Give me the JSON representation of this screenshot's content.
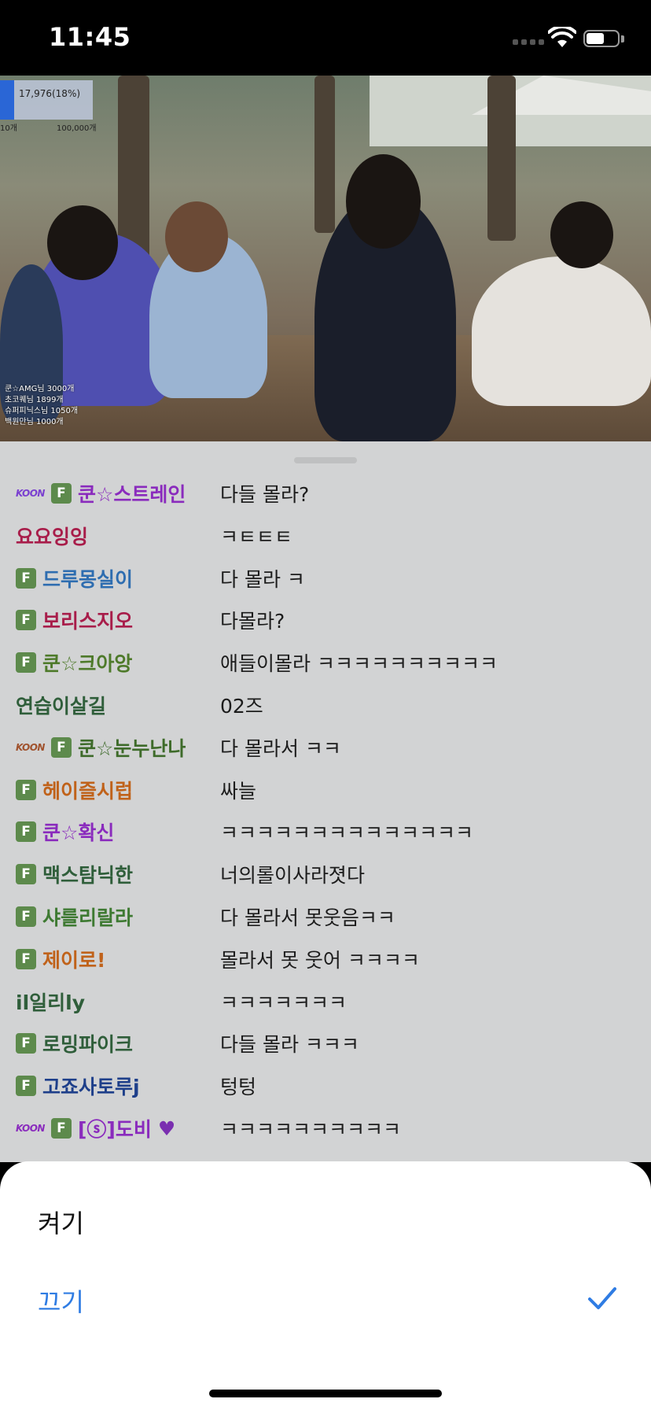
{
  "status_bar": {
    "time": "11:45"
  },
  "video": {
    "stat_main": "17,976(18%)",
    "stat_left": "10개",
    "stat_right": "100,000개",
    "donors": [
      "쿤☆AMG님 3000개",
      "초코퀘님 1899개",
      "슈퍼피닉스님 1050개",
      "백원만님 1000개"
    ]
  },
  "chat": {
    "messages": [
      {
        "user": "쿤☆스트레인",
        "color": "#8a2bbd",
        "koon": "KOON",
        "koon_color": "#7a3fd0",
        "fan": "F",
        "text": "다들 몰라?"
      },
      {
        "user": "요요잉잉",
        "color": "#a81d4a",
        "koon": "",
        "fan": "",
        "text": "ㅋㅌㅌㅌ"
      },
      {
        "user": "드루몽실이",
        "color": "#2e6db0",
        "koon": "",
        "fan": "F",
        "text": "다 몰라 ㅋ"
      },
      {
        "user": "보리스지오",
        "color": "#a81d4a",
        "koon": "",
        "fan": "F",
        "text": "다몰라?"
      },
      {
        "user": "쿤☆크아앙",
        "color": "#4e7a2a",
        "koon": "",
        "fan": "F",
        "text": "애들이몰라 ㅋㅋㅋㅋㅋㅋㅋㅋㅋㅋ"
      },
      {
        "user": "연습이살길",
        "color": "#2f5e3a",
        "koon": "",
        "fan": "",
        "text": "02즈"
      },
      {
        "user": "쿤☆눈누난나",
        "color": "#3e6b2a",
        "koon": "KOON",
        "koon_color": "#a0522d",
        "fan": "F",
        "text": "다 몰라서 ㅋㅋ"
      },
      {
        "user": "헤이즐시럽",
        "color": "#c0621a",
        "koon": "",
        "fan": "F",
        "text": "싸늘"
      },
      {
        "user": "쿤☆확신",
        "color": "#8a2bbd",
        "koon": "",
        "fan": "F",
        "text": "ㅋㅋㅋㅋㅋㅋㅋㅋㅋㅋㅋㅋㅋㅋ"
      },
      {
        "user": "맥스탐닉한",
        "color": "#2f5e3a",
        "koon": "",
        "fan": "F",
        "text": "너의롤이사라졋다"
      },
      {
        "user": "샤를리랄라",
        "color": "#3e7a32",
        "koon": "",
        "fan": "F",
        "text": "다 몰라서 못웃음ㅋㅋ"
      },
      {
        "user": "제이로!",
        "color": "#c0621a",
        "koon": "",
        "fan": "F",
        "text": "몰라서 못 웃어 ㅋㅋㅋㅋ"
      },
      {
        "user": "il일리ly",
        "color": "#2f5e3a",
        "koon": "",
        "fan": "",
        "text": "ㅋㅋㅋㅋㅋㅋㅋ"
      },
      {
        "user": "로밍파이크",
        "color": "#2f5e3a",
        "koon": "",
        "fan": "F",
        "text": "다들 몰라 ㅋㅋㅋ"
      },
      {
        "user": "고죠사토루j",
        "color": "#1e3f8a",
        "koon": "",
        "fan": "F",
        "text": "텅텅"
      },
      {
        "user": "[ⓢ]도비",
        "color": "#8a2bbd",
        "koon": "KOON",
        "koon_color": "#8a2bbd",
        "fan": "F",
        "text": "ㅋㅋㅋㅋㅋㅋㅋㅋㅋㅋ",
        "heart": "💜"
      }
    ]
  },
  "sheet": {
    "option_on": "켜기",
    "option_off": "끄기",
    "selected": "끄기",
    "accent": "#2f7ce3"
  }
}
